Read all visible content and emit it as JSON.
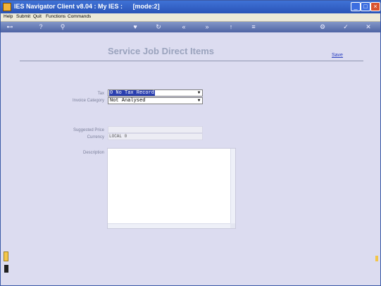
{
  "window": {
    "title": "IES Navigator Client v8.04 : My IES :",
    "mode": "[mode:2]"
  },
  "menu": [
    "Help",
    "Submit",
    "Quit",
    "Functions",
    "Commands"
  ],
  "toolbar": {
    "icons": [
      "key-icon",
      "info-icon",
      "search-icon",
      "heart-icon",
      "refresh-icon",
      "back-icon",
      "forward-icon",
      "up-icon",
      "list-icon",
      "settings-icon",
      "check-icon",
      "close-icon"
    ]
  },
  "page": {
    "heading": "Service Job Direct Items",
    "save_label": "Save"
  },
  "form": {
    "tax_label": "Tax",
    "tax_value": "0 No Tax Record",
    "invoice_category_label": "Invoice Category",
    "invoice_category_value": "Not Analysed",
    "suggested_price_label": "Suggested Price",
    "suggested_price_value": "",
    "currency_label": "Currency",
    "currency_value": "LOCAL 0",
    "description_label": "Description",
    "description_value": ""
  }
}
